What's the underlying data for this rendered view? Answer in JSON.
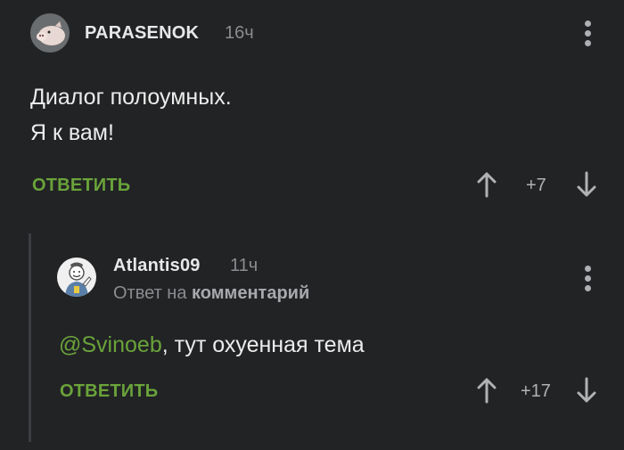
{
  "comment1": {
    "username": "PARASENOK",
    "time": "16ч",
    "lines": [
      "Диалог полоумных.",
      "Я к вам!"
    ],
    "reply_label": "ОТВЕТИТЬ",
    "rating": "+7"
  },
  "comment2": {
    "username": "Atlantis09",
    "time": "11ч",
    "reply_to_prefix": "Ответ на",
    "reply_to_target": "комментарий",
    "mention": "@Svinoeb",
    "text": ", тут охуенная тема",
    "reply_label": "ОТВЕТИТЬ",
    "rating": "+17"
  },
  "icons": {
    "up": "arrow-up-icon",
    "down": "arrow-down-icon",
    "menu": "more-vertical-icon"
  },
  "colors": {
    "background": "#222325",
    "accent_green": "#6aa33a",
    "muted": "#8a8c8f"
  }
}
